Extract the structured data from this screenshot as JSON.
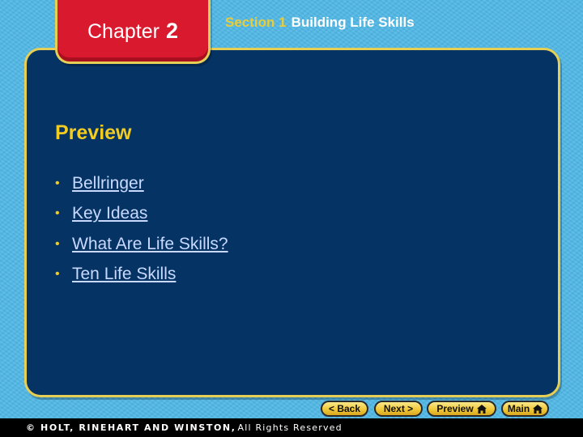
{
  "header": {
    "chapter_label": "Chapter",
    "chapter_number": "2",
    "section_label": "Section 1",
    "section_title": "Building Life Skills"
  },
  "main": {
    "heading": "Preview",
    "bullet_glyph": "•",
    "links": [
      {
        "label": "Bellringer"
      },
      {
        "label": "Key Ideas"
      },
      {
        "label": "What Are Life Skills?"
      },
      {
        "label": "Ten Life Skills"
      }
    ]
  },
  "nav": {
    "back": "< Back",
    "next": "Next >",
    "preview": "Preview",
    "main": "Main",
    "home_icon": "home-icon"
  },
  "footer": {
    "copyright": "© HOLT, RINEHART AND WINSTON,",
    "rights": "All Rights Reserved"
  },
  "colors": {
    "background": "#4fb8e6",
    "panel": "#043364",
    "border_gold": "#e7cf56",
    "chapter_red": "#d9192e",
    "heading_yellow": "#f2cc21",
    "link": "#c9d9ff"
  }
}
